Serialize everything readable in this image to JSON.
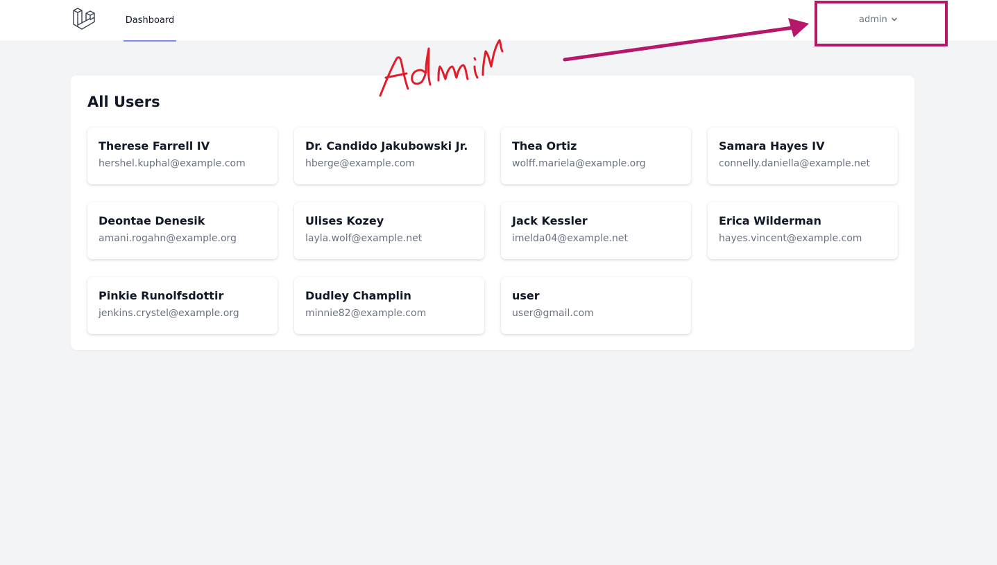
{
  "nav": {
    "links": [
      {
        "label": "Dashboard",
        "active": true
      }
    ],
    "user_menu": {
      "label": "admin"
    }
  },
  "main": {
    "title": "All Users",
    "users": [
      {
        "name": "Therese Farrell IV",
        "email": "hershel.kuphal@example.com"
      },
      {
        "name": "Dr. Candido Jakubowski Jr.",
        "email": "hberge@example.com"
      },
      {
        "name": "Thea Ortiz",
        "email": "wolff.mariela@example.org"
      },
      {
        "name": "Samara Hayes IV",
        "email": "connelly.daniella@example.net"
      },
      {
        "name": "Deontae Denesik",
        "email": "amani.rogahn@example.org"
      },
      {
        "name": "Ulises Kozey",
        "email": "layla.wolf@example.net"
      },
      {
        "name": "Jack Kessler",
        "email": "imelda04@example.net"
      },
      {
        "name": "Erica Wilderman",
        "email": "hayes.vincent@example.com"
      },
      {
        "name": "Pinkie Runolfsdottir",
        "email": "jenkins.crystel@example.org"
      },
      {
        "name": "Dudley Champlin",
        "email": "minnie82@example.com"
      },
      {
        "name": "user",
        "email": "user@gmail.com"
      }
    ]
  },
  "annotation": {
    "handwritten_text": "Admin",
    "text_color": "#e11d2a",
    "arrow_color": "#b5176a",
    "box_color": "#b5176a"
  },
  "colors": {
    "accent": "#818cf8",
    "background": "#f3f4f6",
    "muted_text": "#6b7280"
  },
  "icons": {
    "logo": "laravel-logo-icon",
    "dropdown": "chevron-down-icon"
  }
}
